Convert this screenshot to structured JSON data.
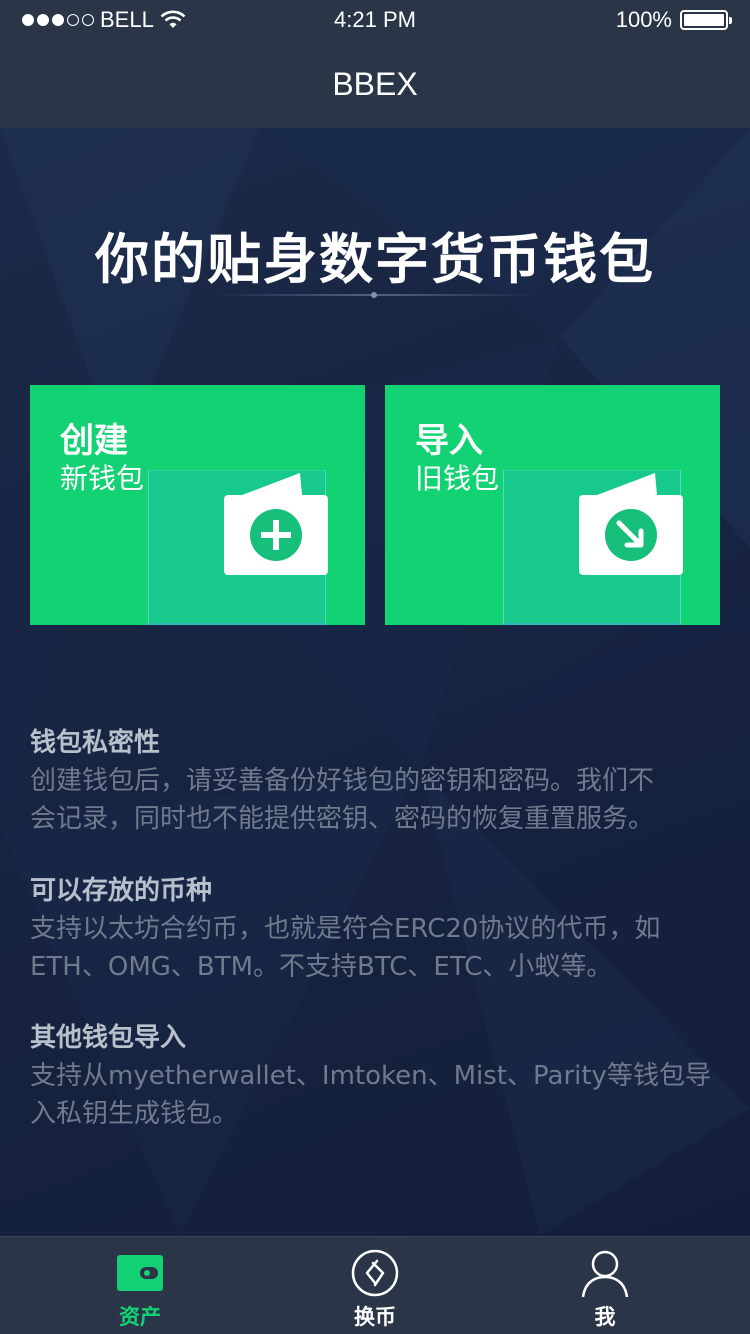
{
  "status_bar": {
    "carrier": "BELL",
    "time": "4:21 PM",
    "battery": "100%",
    "signal_dots_full": 3,
    "signal_dots_total": 5
  },
  "nav": {
    "title": "BBEX"
  },
  "hero": {
    "title": "你的贴身数字货币钱包"
  },
  "cards": {
    "create": {
      "title": "创建",
      "subtitle": "新钱包",
      "icon": "plus-icon"
    },
    "import": {
      "title": "导入",
      "subtitle": "旧钱包",
      "icon": "arrow-down-icon"
    }
  },
  "info": [
    {
      "title": "钱包私密性",
      "lines": [
        "创建钱包后，请妥善备份好钱包的密钥和密码。我们不",
        "会记录，同时也不能提供密钥、密码的恢复重置服务。"
      ]
    },
    {
      "title": "可以存放的币种",
      "lines": [
        "支持以太坊合约币，也就是符合ERC20协议的代币，如",
        "ETH、OMG、BTM。不支持BTC、ETC、小蚁等。"
      ]
    },
    {
      "title": "其他钱包导入",
      "lines": [
        "支持从myetherwallet、Imtoken、Mist、Parity等钱包导",
        "入私钥生成钱包。"
      ]
    }
  ],
  "tabs": [
    {
      "label": "资产",
      "icon": "wallet-icon",
      "active": true
    },
    {
      "label": "换币",
      "icon": "exchange-icon",
      "active": false
    },
    {
      "label": "我",
      "icon": "user-icon",
      "active": false
    }
  ],
  "colors": {
    "accent": "#12d274",
    "bar_bg": "#2a3548",
    "content_bg": "#172442",
    "info_title": "#b8c0cc",
    "info_body": "#6f7a8d"
  }
}
